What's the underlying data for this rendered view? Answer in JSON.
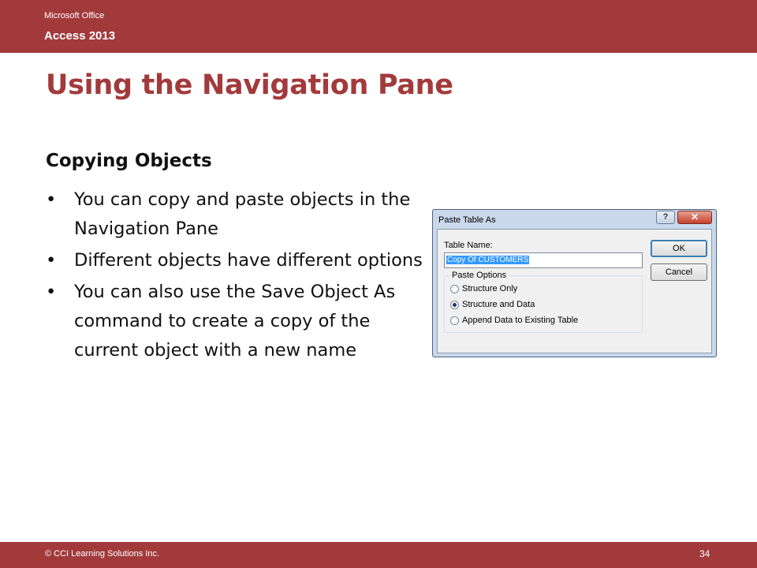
{
  "header": {
    "brand_line1": "Microsoft Office",
    "brand_line2": "Access 2013",
    "color": "#a23a3c"
  },
  "slide": {
    "title": "Using the Navigation Pane",
    "subheading": "Copying Objects",
    "bullet_symbol": "•",
    "bullets": [
      "You can copy and paste objects in the Navigation Pane",
      "Different objects have different options",
      "You can also use the Save Object As command to create a copy of the current object with a new name"
    ]
  },
  "dialog": {
    "title": "Paste Table As",
    "help_icon": "?",
    "close_icon": "✕",
    "table_name_label": "Table Name:",
    "table_name_value": "Copy Of CUSTOMERS",
    "paste_options_label": "Paste Options",
    "options": [
      {
        "label": "Structure Only",
        "checked": false
      },
      {
        "label": "Structure and Data",
        "checked": true
      },
      {
        "label": "Append Data to Existing Table",
        "checked": false
      }
    ],
    "ok_label": "OK",
    "cancel_label": "Cancel"
  },
  "footer": {
    "copyright": "© CCI Learning Solutions Inc.",
    "page_number": "34"
  }
}
